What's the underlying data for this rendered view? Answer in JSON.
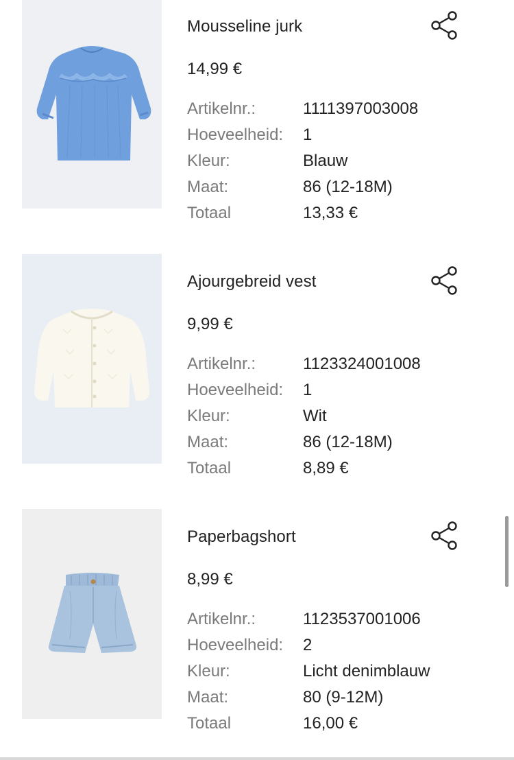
{
  "labels": {
    "article_no": "Artikelnr.:",
    "quantity": "Hoeveelheid:",
    "color": "Kleur:",
    "size": "Maat:",
    "total": "Totaal"
  },
  "share_icon": "share-icon",
  "items": [
    {
      "name": "Mousseline jurk",
      "price": "14,99 €",
      "article_no": "1111397003008",
      "quantity": "1",
      "color": "Blauw",
      "size": "86 (12-18M)",
      "total": "13,33 €",
      "image_bg": "#eef0f4",
      "garment_color": "#6f9fdc"
    },
    {
      "name": "Ajourgebreid vest",
      "price": "9,99 €",
      "article_no": "1123324001008",
      "quantity": "1",
      "color": "Wit",
      "size": "86 (12-18M)",
      "total": "8,89 €",
      "image_bg": "#e9eef4",
      "garment_color": "#faf8ee"
    },
    {
      "name": "Paperbagshort",
      "price": "8,99 €",
      "article_no": "1123537001006",
      "quantity": "2",
      "color": "Licht denimblauw",
      "size": "80 (9-12M)",
      "total": "16,00 €",
      "image_bg": "#efefef",
      "garment_color": "#a9c2dd"
    }
  ]
}
